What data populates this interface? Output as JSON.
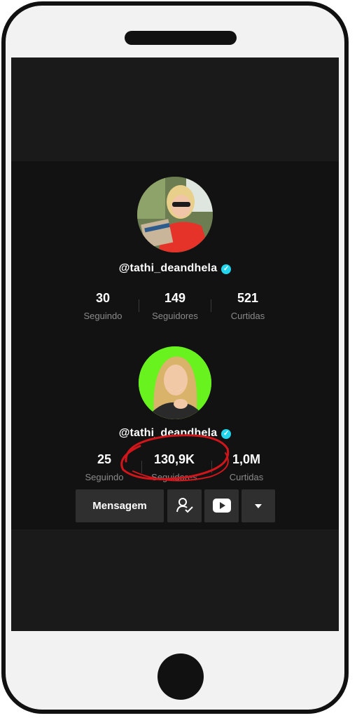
{
  "profile_old": {
    "handle": "@tathi_deandhela",
    "stats": [
      {
        "value": "30",
        "label": "Seguindo"
      },
      {
        "value": "149",
        "label": "Seguidores"
      },
      {
        "value": "521",
        "label": "Curtidas"
      }
    ]
  },
  "profile_new": {
    "handle": "@tathi_deandhela",
    "stats": [
      {
        "value": "25",
        "label": "Seguindo"
      },
      {
        "value": "130,9K",
        "label": "Seguidores"
      },
      {
        "value": "1,0M",
        "label": "Curtidas"
      }
    ],
    "actions": {
      "message_label": "Mensagem",
      "follow_icon": "user-check-icon",
      "youtube_icon": "youtube-icon",
      "more_icon": "triangle-down-icon"
    }
  },
  "colors": {
    "verified": "#20d5ec",
    "avatar_bg_new": "#68f21e",
    "highlight_circle": "#d0161b"
  }
}
